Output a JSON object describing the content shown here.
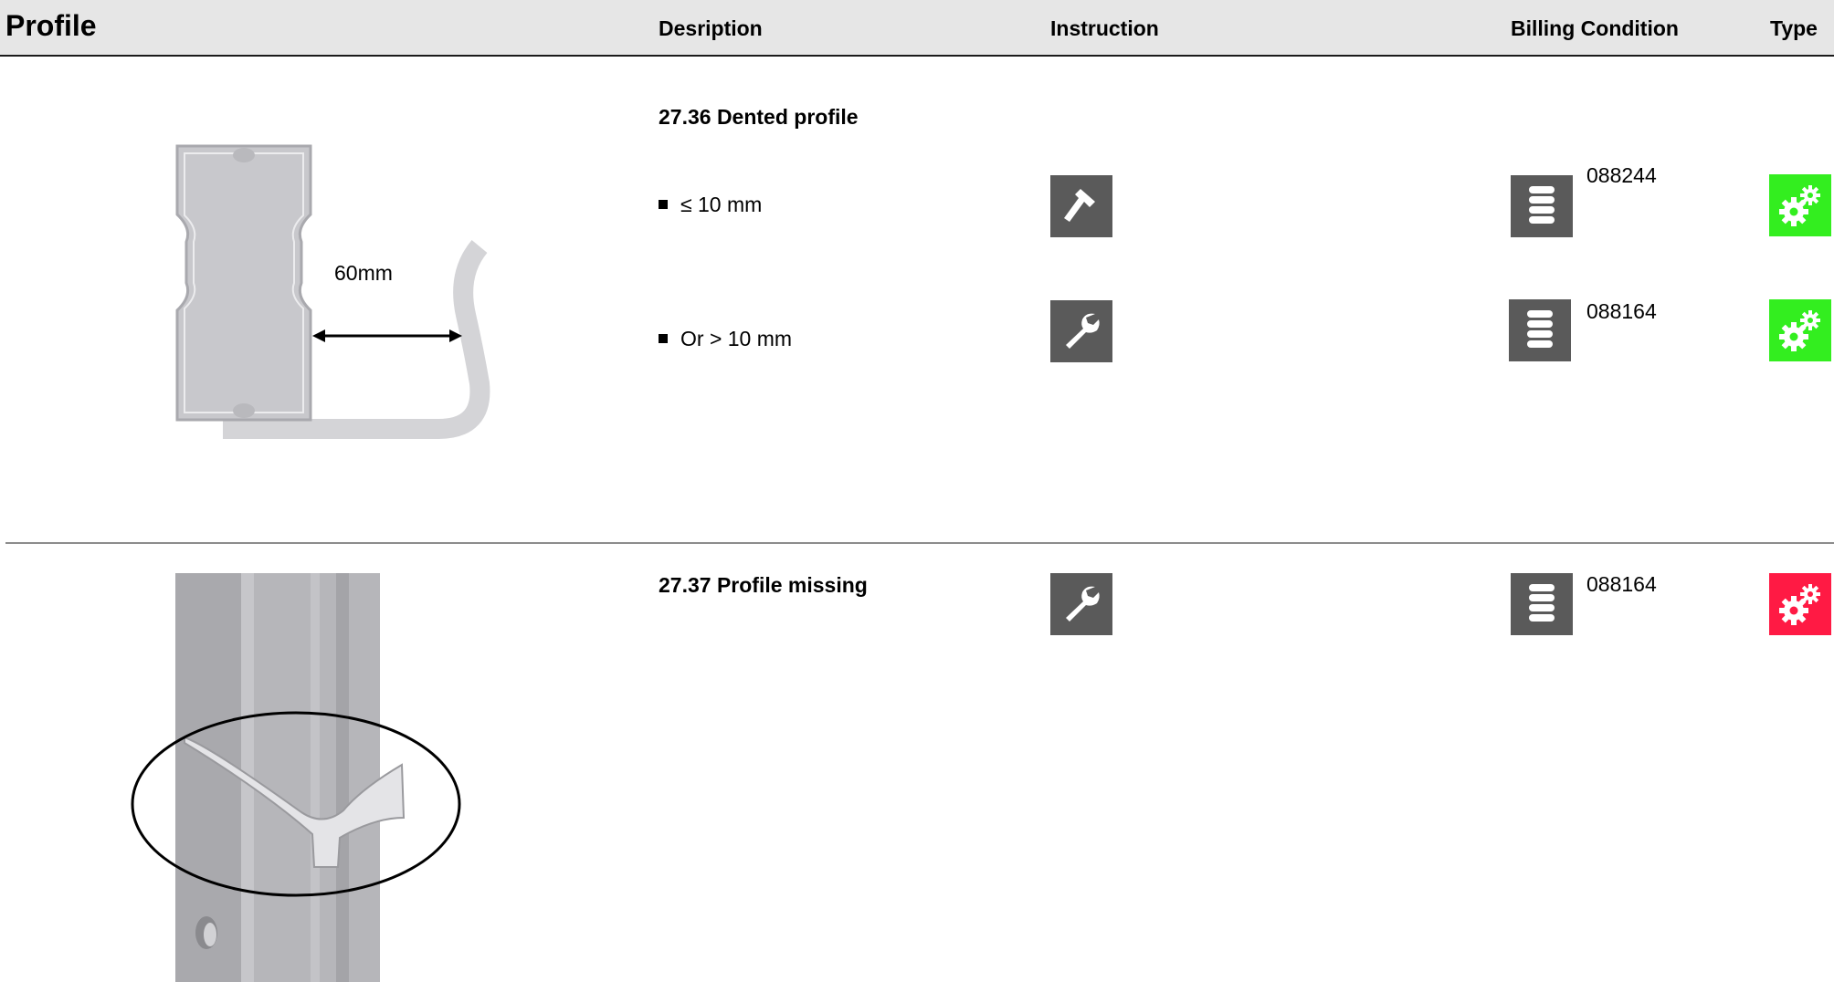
{
  "header": {
    "title": "Profile",
    "col_description": "Desription",
    "col_instruction": "Instruction",
    "col_billing": "Billing Condition",
    "col_type": "Type"
  },
  "rows": [
    {
      "title": "27.36 Dented profile",
      "illustration_label": "60mm",
      "options": [
        {
          "text": "≤ 10 mm",
          "instruction_icon": "hammer-icon",
          "billing_icon": "coins-stack-icon",
          "billing_code": "088244",
          "type_color": "#33ee1f",
          "type_icon": "gears-icon"
        },
        {
          "text": "Or > 10 mm",
          "instruction_icon": "wrench-icon",
          "billing_icon": "coins-stack-icon",
          "billing_code": "088164",
          "type_color": "#33ee1f",
          "type_icon": "gears-icon"
        }
      ]
    },
    {
      "title": "27.37 Profile missing",
      "instruction_icon": "wrench-icon",
      "billing_icon": "coins-stack-icon",
      "billing_code": "088164",
      "type_color": "#ff1a44",
      "type_icon": "gears-icon"
    }
  ],
  "colors": {
    "header_bg": "#e6e6e6",
    "icon_bg": "#5a5a5a",
    "type_ok": "#33ee1f",
    "type_alert": "#ff1a44"
  }
}
